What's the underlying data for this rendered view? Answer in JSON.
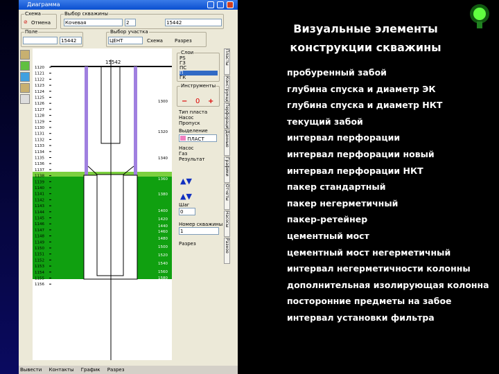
{
  "window": {
    "title": "Диаграмма",
    "minimize": "_",
    "maximize": "□",
    "close": "×"
  },
  "toolbar": {
    "scheme_group": "Схема",
    "scheme_button": "Отмена",
    "well_group": "Выбор скважины",
    "well_value": "Кочевая",
    "num_value": "2",
    "well_code": "15442",
    "field_group": "Поле",
    "field_value": "",
    "field_code": "15442",
    "sel_group": "Выбор участка",
    "sel_value": "ЦЕНТ",
    "opt1": "Схема",
    "opt2": "Разрез"
  },
  "drawing": {
    "header": "15542",
    "depth_labels": [
      "1120",
      "1121",
      "1122",
      "1123",
      "1124",
      "1125",
      "1126",
      "1127",
      "1128",
      "1129",
      "1130",
      "1131",
      "1132",
      "1133",
      "1134",
      "1135",
      "1136",
      "1137",
      "1138",
      "1139",
      "1140",
      "1141",
      "1142",
      "1143",
      "1144",
      "1145",
      "1146",
      "1147",
      "1148",
      "1149",
      "1150",
      "1151",
      "1152",
      "1153",
      "1154",
      "1155",
      "1156"
    ],
    "right_labels": [
      "1300",
      "1320",
      "1340",
      "1360",
      "1380",
      "1400",
      "1420",
      "1440",
      "1460",
      "1480",
      "1500",
      "1520",
      "1540",
      "1560",
      "1580"
    ]
  },
  "panel": {
    "layers": "Слои",
    "layer_items": [
      "PS",
      "ГЗ",
      "ПС",
      "П",
      "ГК"
    ],
    "tools": "Инструменты",
    "mode": "Тип пласта",
    "mode_opts": [
      "Насос",
      "Пропуск"
    ],
    "fill": "Выделение",
    "fill_value": "ПЛАСТ",
    "fill_opts": [
      "Насос",
      "Газ",
      "Результат"
    ],
    "step": "Шаг",
    "step_value": "0",
    "well_no": "Номер скважины",
    "well_no_value": "1",
    "print": "Разрез"
  },
  "tabs": [
    "Пласты",
    "Конструкция",
    "Перфорация",
    "Данные",
    "Графики",
    "Отчеты",
    "Насосы",
    "Разное"
  ],
  "status": [
    "Вывести",
    "Контакты",
    "График",
    "Разрез"
  ],
  "slide": {
    "title_line1": "Визуальные элементы",
    "title_line2": "конструкции скважины",
    "items": [
      "пробуренный забой",
      "глубина спуска и диаметр ЭК",
      "глубина спуска и диаметр НКТ",
      "текущий забой",
      "интервал перфорации",
      "интервал перфорации новый",
      "интервал перфорации НКТ",
      "пакер стандартный",
      "пакер негерметичный",
      "пакер-ретейнер",
      "цементный мост",
      "цементный мост негерметичный",
      "интервал негерметичности колонны",
      "дополнительная изолирующая колонна",
      "посторонние предметы на забое",
      "интервал установки фильтра"
    ]
  },
  "colors": {
    "green": "#10a010",
    "purple": "#a080e0",
    "titlebar": "#0a4fd0"
  }
}
